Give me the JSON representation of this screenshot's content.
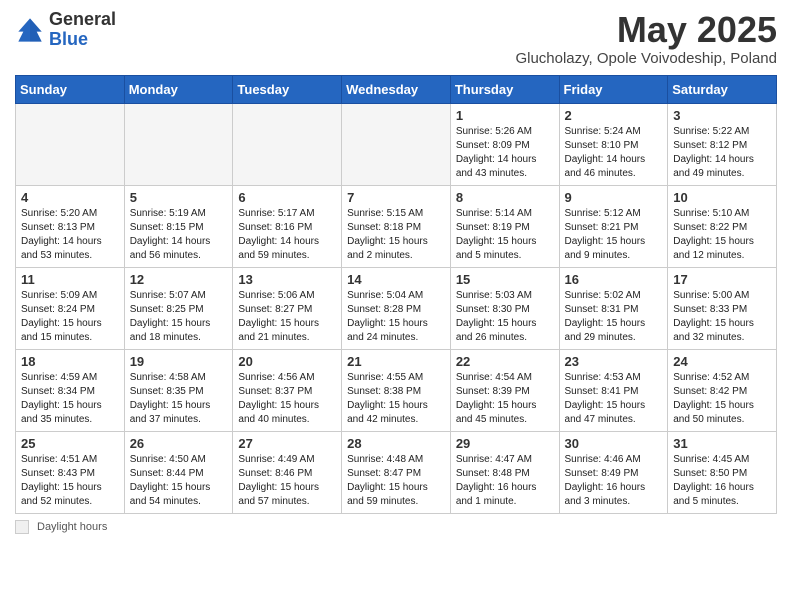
{
  "header": {
    "logo_general": "General",
    "logo_blue": "Blue",
    "month_title": "May 2025",
    "subtitle": "Glucholazy, Opole Voivodeship, Poland"
  },
  "days_of_week": [
    "Sunday",
    "Monday",
    "Tuesday",
    "Wednesday",
    "Thursday",
    "Friday",
    "Saturday"
  ],
  "weeks": [
    [
      {
        "num": "",
        "info": "",
        "empty": true
      },
      {
        "num": "",
        "info": "",
        "empty": true
      },
      {
        "num": "",
        "info": "",
        "empty": true
      },
      {
        "num": "",
        "info": "",
        "empty": true
      },
      {
        "num": "1",
        "info": "Sunrise: 5:26 AM\nSunset: 8:09 PM\nDaylight: 14 hours\nand 43 minutes."
      },
      {
        "num": "2",
        "info": "Sunrise: 5:24 AM\nSunset: 8:10 PM\nDaylight: 14 hours\nand 46 minutes."
      },
      {
        "num": "3",
        "info": "Sunrise: 5:22 AM\nSunset: 8:12 PM\nDaylight: 14 hours\nand 49 minutes."
      }
    ],
    [
      {
        "num": "4",
        "info": "Sunrise: 5:20 AM\nSunset: 8:13 PM\nDaylight: 14 hours\nand 53 minutes."
      },
      {
        "num": "5",
        "info": "Sunrise: 5:19 AM\nSunset: 8:15 PM\nDaylight: 14 hours\nand 56 minutes."
      },
      {
        "num": "6",
        "info": "Sunrise: 5:17 AM\nSunset: 8:16 PM\nDaylight: 14 hours\nand 59 minutes."
      },
      {
        "num": "7",
        "info": "Sunrise: 5:15 AM\nSunset: 8:18 PM\nDaylight: 15 hours\nand 2 minutes."
      },
      {
        "num": "8",
        "info": "Sunrise: 5:14 AM\nSunset: 8:19 PM\nDaylight: 15 hours\nand 5 minutes."
      },
      {
        "num": "9",
        "info": "Sunrise: 5:12 AM\nSunset: 8:21 PM\nDaylight: 15 hours\nand 9 minutes."
      },
      {
        "num": "10",
        "info": "Sunrise: 5:10 AM\nSunset: 8:22 PM\nDaylight: 15 hours\nand 12 minutes."
      }
    ],
    [
      {
        "num": "11",
        "info": "Sunrise: 5:09 AM\nSunset: 8:24 PM\nDaylight: 15 hours\nand 15 minutes."
      },
      {
        "num": "12",
        "info": "Sunrise: 5:07 AM\nSunset: 8:25 PM\nDaylight: 15 hours\nand 18 minutes."
      },
      {
        "num": "13",
        "info": "Sunrise: 5:06 AM\nSunset: 8:27 PM\nDaylight: 15 hours\nand 21 minutes."
      },
      {
        "num": "14",
        "info": "Sunrise: 5:04 AM\nSunset: 8:28 PM\nDaylight: 15 hours\nand 24 minutes."
      },
      {
        "num": "15",
        "info": "Sunrise: 5:03 AM\nSunset: 8:30 PM\nDaylight: 15 hours\nand 26 minutes."
      },
      {
        "num": "16",
        "info": "Sunrise: 5:02 AM\nSunset: 8:31 PM\nDaylight: 15 hours\nand 29 minutes."
      },
      {
        "num": "17",
        "info": "Sunrise: 5:00 AM\nSunset: 8:33 PM\nDaylight: 15 hours\nand 32 minutes."
      }
    ],
    [
      {
        "num": "18",
        "info": "Sunrise: 4:59 AM\nSunset: 8:34 PM\nDaylight: 15 hours\nand 35 minutes."
      },
      {
        "num": "19",
        "info": "Sunrise: 4:58 AM\nSunset: 8:35 PM\nDaylight: 15 hours\nand 37 minutes."
      },
      {
        "num": "20",
        "info": "Sunrise: 4:56 AM\nSunset: 8:37 PM\nDaylight: 15 hours\nand 40 minutes."
      },
      {
        "num": "21",
        "info": "Sunrise: 4:55 AM\nSunset: 8:38 PM\nDaylight: 15 hours\nand 42 minutes."
      },
      {
        "num": "22",
        "info": "Sunrise: 4:54 AM\nSunset: 8:39 PM\nDaylight: 15 hours\nand 45 minutes."
      },
      {
        "num": "23",
        "info": "Sunrise: 4:53 AM\nSunset: 8:41 PM\nDaylight: 15 hours\nand 47 minutes."
      },
      {
        "num": "24",
        "info": "Sunrise: 4:52 AM\nSunset: 8:42 PM\nDaylight: 15 hours\nand 50 minutes."
      }
    ],
    [
      {
        "num": "25",
        "info": "Sunrise: 4:51 AM\nSunset: 8:43 PM\nDaylight: 15 hours\nand 52 minutes."
      },
      {
        "num": "26",
        "info": "Sunrise: 4:50 AM\nSunset: 8:44 PM\nDaylight: 15 hours\nand 54 minutes."
      },
      {
        "num": "27",
        "info": "Sunrise: 4:49 AM\nSunset: 8:46 PM\nDaylight: 15 hours\nand 57 minutes."
      },
      {
        "num": "28",
        "info": "Sunrise: 4:48 AM\nSunset: 8:47 PM\nDaylight: 15 hours\nand 59 minutes."
      },
      {
        "num": "29",
        "info": "Sunrise: 4:47 AM\nSunset: 8:48 PM\nDaylight: 16 hours\nand 1 minute."
      },
      {
        "num": "30",
        "info": "Sunrise: 4:46 AM\nSunset: 8:49 PM\nDaylight: 16 hours\nand 3 minutes."
      },
      {
        "num": "31",
        "info": "Sunrise: 4:45 AM\nSunset: 8:50 PM\nDaylight: 16 hours\nand 5 minutes."
      }
    ]
  ],
  "footer": {
    "daylight_label": "Daylight hours"
  }
}
